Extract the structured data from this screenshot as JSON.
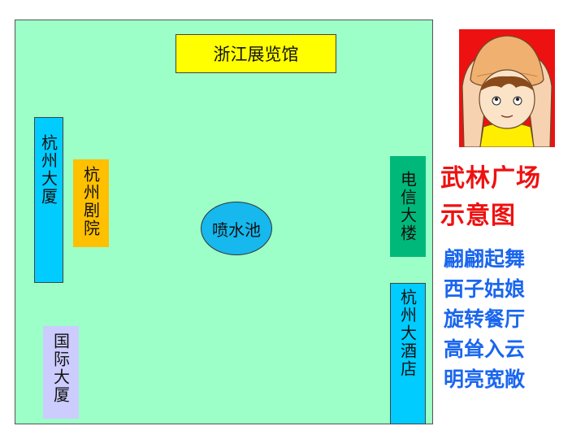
{
  "buildings": {
    "zhejiang_exhibition": "浙江展览馆",
    "hangzhou_mansion": "杭州大厦",
    "hangzhou_theatre": "杭州剧院",
    "telecom_building": "电信大楼",
    "hangzhou_hotel": "杭州大酒店",
    "international_building": "国际大厦",
    "fountain": "喷水池"
  },
  "title": [
    "武林广场",
    "示意图"
  ],
  "phrases": [
    "翩翩起舞",
    "西子姑娘",
    "旋转餐厅",
    "高耸入云",
    "明亮宽敞"
  ],
  "colors": {
    "map_bg": "#9cffc8",
    "exhibition": "#ffff00",
    "cyan": "#00ccff",
    "orange": "#ffc000",
    "green": "#00b87a",
    "lavender": "#ccccff",
    "title_red": "#ee1111",
    "phrase_blue": "#1a66ee"
  }
}
